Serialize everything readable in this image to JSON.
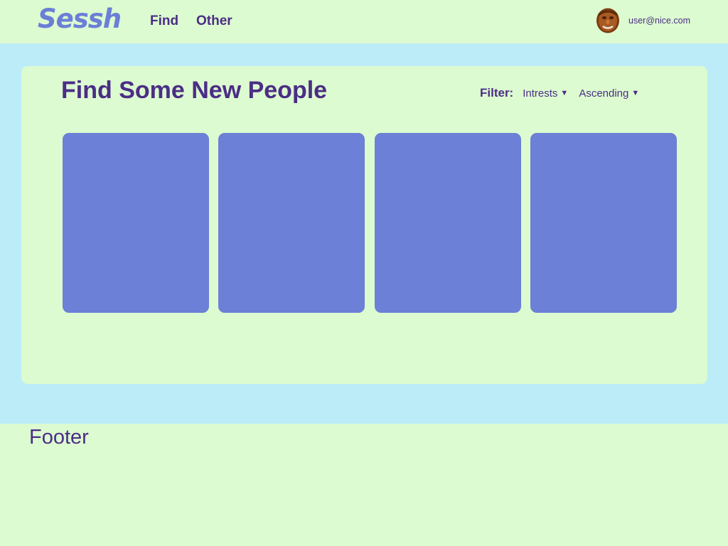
{
  "colors": {
    "page_background": "#dcfbd0",
    "main_background": "#bcecf7",
    "card": "#6b80d6",
    "logo": "#6b7fd7",
    "text": "#4b2d86"
  },
  "navbar": {
    "logo": "Sessh",
    "links": [
      "Find",
      "Other"
    ],
    "avatar_icon": "user-avatar-photo",
    "user_email": "user@nice.com"
  },
  "main": {
    "title": "Find Some New People",
    "filter": {
      "label": "Filter:",
      "interests": "Intrests",
      "order": "Ascending",
      "caret_icon": "triangle-down-icon"
    },
    "cards": [
      {
        "name": "person-card-1"
      },
      {
        "name": "person-card-2"
      },
      {
        "name": "person-card-3"
      },
      {
        "name": "person-card-4"
      }
    ]
  },
  "footer": {
    "text": "Footer"
  }
}
